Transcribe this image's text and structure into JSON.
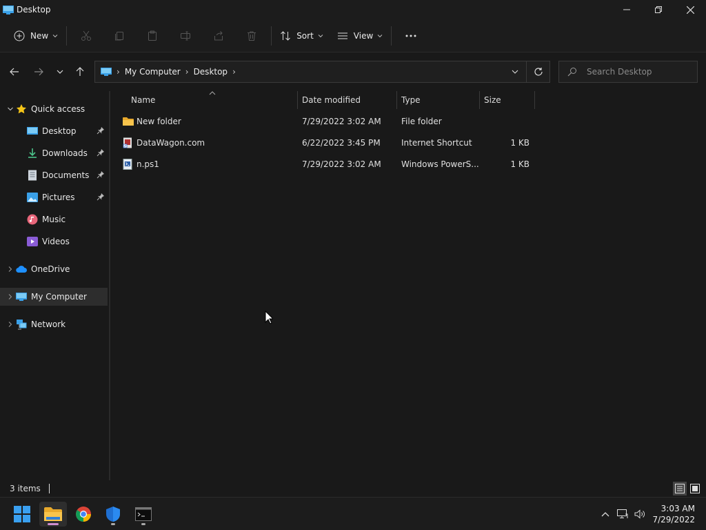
{
  "window": {
    "title": "Desktop"
  },
  "toolbar": {
    "new_label": "New",
    "sort_label": "Sort",
    "view_label": "View"
  },
  "address": {
    "crumbs": [
      "My Computer",
      "Desktop"
    ]
  },
  "search": {
    "placeholder": "Search Desktop"
  },
  "sidebar": {
    "quick_access": "Quick access",
    "items": [
      {
        "label": "Desktop",
        "pinned": true
      },
      {
        "label": "Downloads",
        "pinned": true
      },
      {
        "label": "Documents",
        "pinned": true
      },
      {
        "label": "Pictures",
        "pinned": true
      },
      {
        "label": "Music",
        "pinned": false
      },
      {
        "label": "Videos",
        "pinned": false
      }
    ],
    "onedrive": "OneDrive",
    "my_computer": "My Computer",
    "network": "Network"
  },
  "columns": {
    "name": "Name",
    "date": "Date modified",
    "type": "Type",
    "size": "Size"
  },
  "files": [
    {
      "name": "New folder",
      "date": "7/29/2022 3:02 AM",
      "type": "File folder",
      "size": ""
    },
    {
      "name": "DataWagon.com",
      "date": "6/22/2022 3:45 PM",
      "type": "Internet Shortcut",
      "size": "1 KB"
    },
    {
      "name": "n.ps1",
      "date": "7/29/2022 3:02 AM",
      "type": "Windows PowerS...",
      "size": "1 KB"
    }
  ],
  "status": {
    "item_count": "3 items"
  },
  "taskbar": {
    "time": "3:03 AM",
    "date": "7/29/2022"
  },
  "colors": {
    "accent": "#0078d4",
    "folder": "#f8c44c",
    "selected": "#2d2d2d",
    "background": "#191919"
  }
}
